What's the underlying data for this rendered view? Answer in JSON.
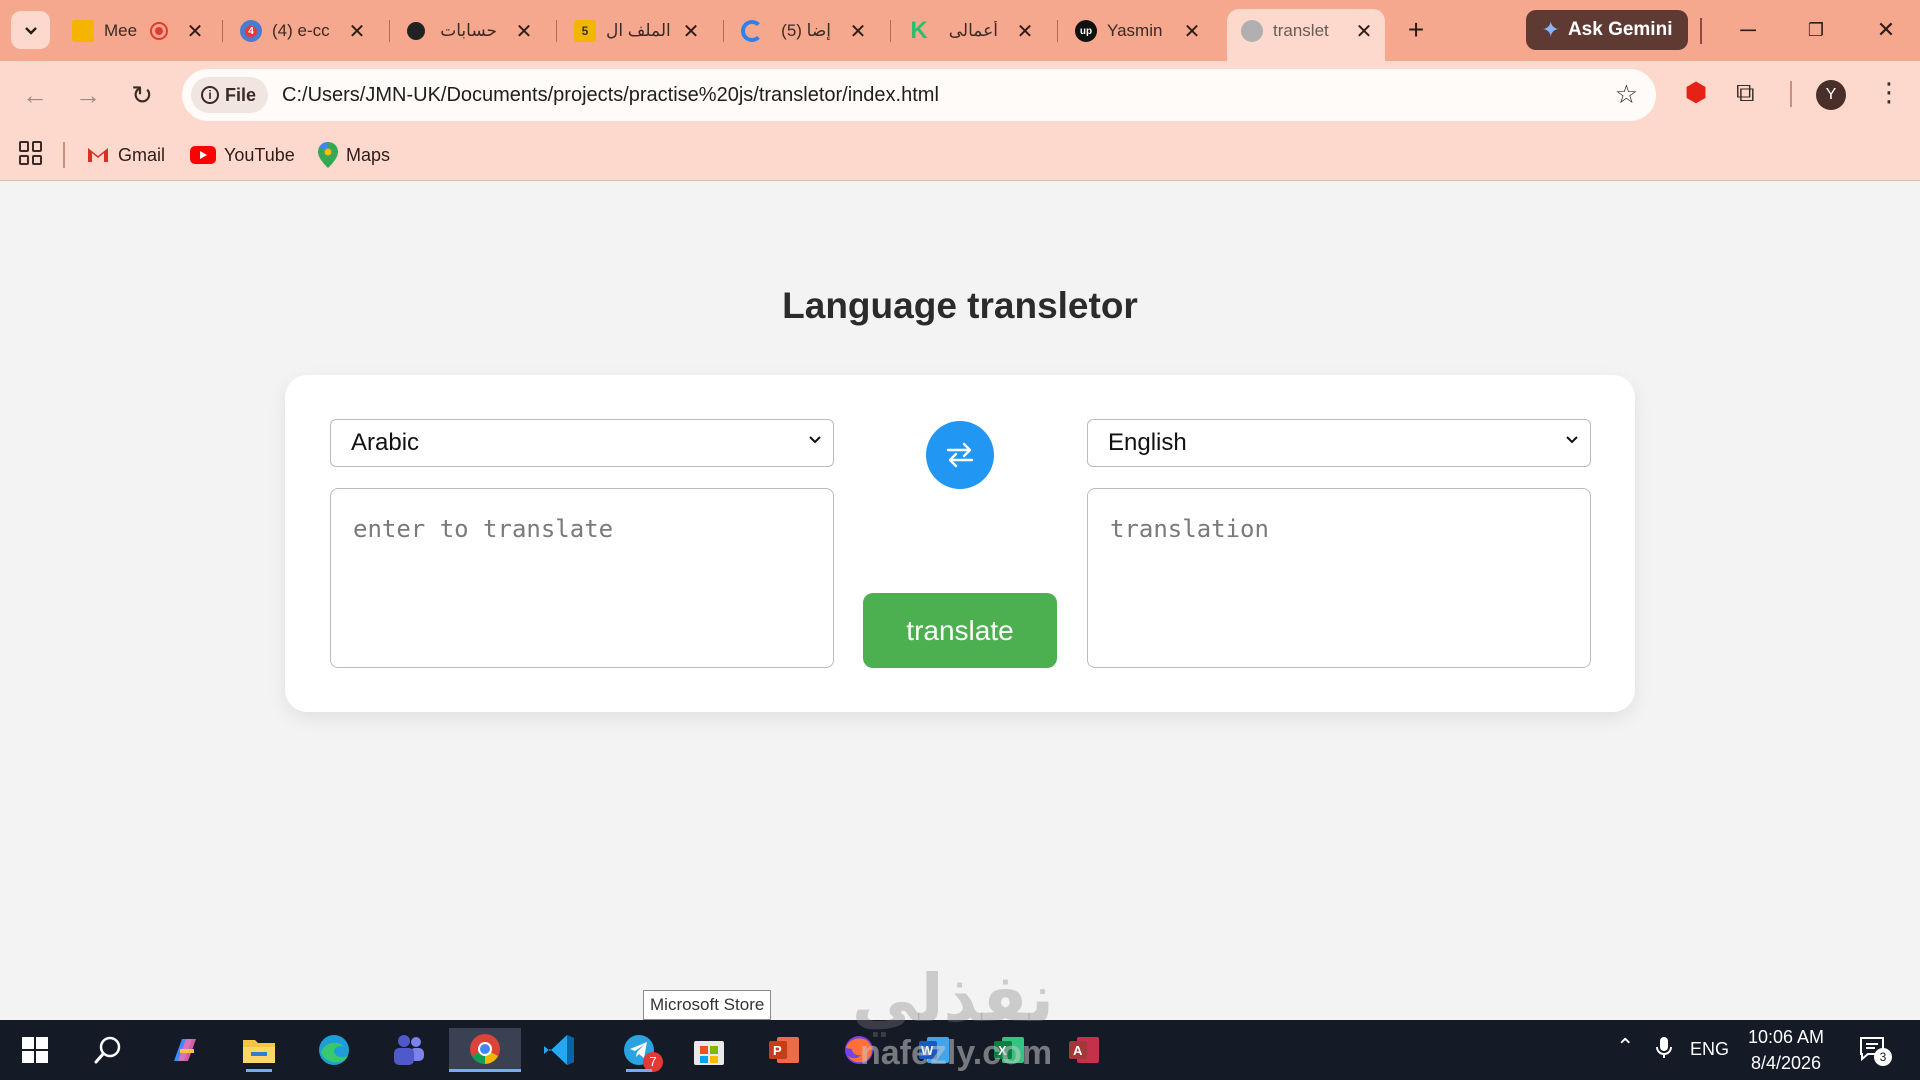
{
  "browser": {
    "tabs": [
      {
        "title": "Mee",
        "icon": "meet-icon",
        "favicon_color": "#f4b400"
      },
      {
        "title": "(4) e-cc",
        "icon": "ecommerce-icon",
        "favicon_color": "#4a7bd0",
        "badge": "4"
      },
      {
        "title": "حسابات",
        "icon": "accounts-icon",
        "favicon_color": "#222222"
      },
      {
        "title": "الملف ال",
        "icon": "file-icon",
        "favicon_color": "#f2b600",
        "badge": "5"
      },
      {
        "title": "(5) إضا",
        "icon": "add-icon",
        "favicon_color": "#2f80ed"
      },
      {
        "title": "أعمالى",
        "icon": "khamsat-icon",
        "favicon_color": "#2dbd6e"
      },
      {
        "title": "Yasmin",
        "icon": "upwork-icon",
        "favicon_color": "#111111"
      },
      {
        "title": "translet",
        "icon": "globe-icon",
        "favicon_color": "#9a9a9a",
        "active": true
      }
    ],
    "ask_gemini_label": "Ask Gemini",
    "address": {
      "chip_label": "File",
      "url": "C:/Users/JMN-UK/Documents/projects/practise%20js/transletor/index.html"
    },
    "profile_initial": "Y",
    "bookmarks": [
      {
        "label": "Gmail",
        "icon": "gmail-icon"
      },
      {
        "label": "YouTube",
        "icon": "youtube-icon"
      },
      {
        "label": "Maps",
        "icon": "maps-icon"
      }
    ]
  },
  "page": {
    "title": "Language transletor",
    "source_language": "Arabic",
    "target_language": "English",
    "source_placeholder": "enter to translate",
    "target_placeholder": "translation",
    "translate_label": "translate"
  },
  "tooltip": "Microsoft Store",
  "taskbar": {
    "telegram_badge": "7",
    "language": "ENG",
    "time": "10:06 AM",
    "date": "8/4/2026",
    "notifications_count": "3"
  },
  "watermark": {
    "arabic": "نفذلي",
    "latin": "nafezly.com"
  },
  "colors": {
    "tabstrip": "#f5a88d",
    "toolbar": "#fcd9cc",
    "swap_button": "#2196f3",
    "translate_button": "#4caf50",
    "taskbar": "#141a26"
  }
}
